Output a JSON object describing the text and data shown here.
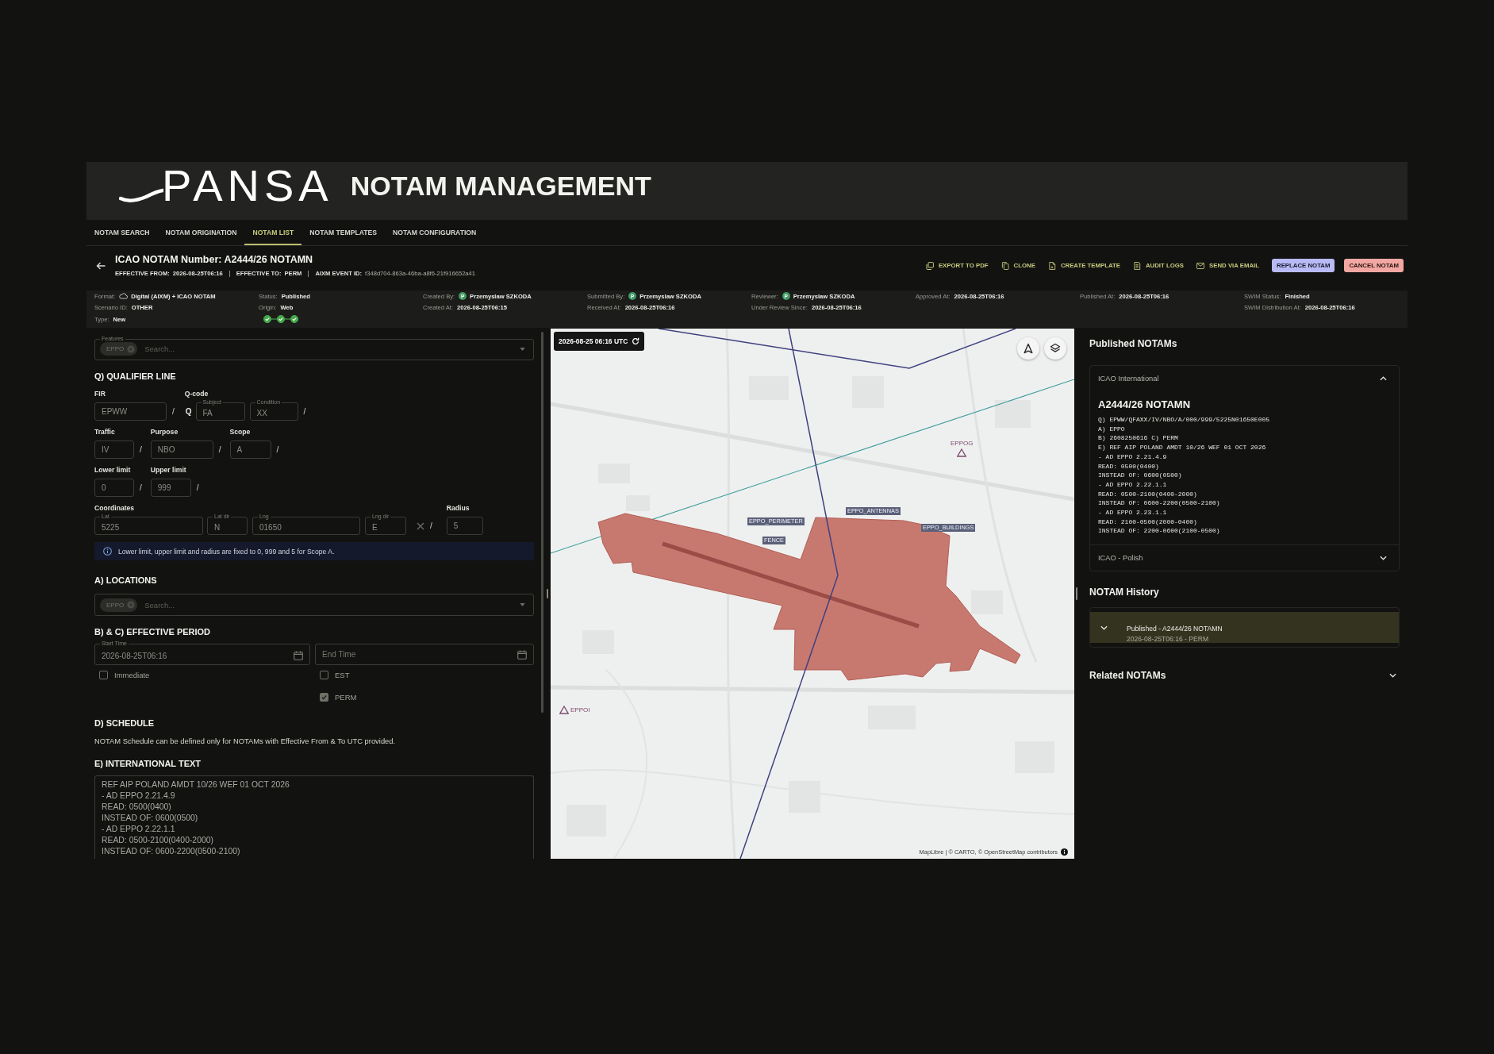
{
  "header": {
    "logo": "PANSA",
    "title": "NOTAM MANAGEMENT"
  },
  "tabs": [
    {
      "label": "NOTAM SEARCH",
      "selected": false
    },
    {
      "label": "NOTAM ORIGINATION",
      "selected": false
    },
    {
      "label": "NOTAM LIST",
      "selected": true
    },
    {
      "label": "NOTAM TEMPLATES",
      "selected": false
    },
    {
      "label": "NOTAM CONFIGURATION",
      "selected": false
    }
  ],
  "notam": {
    "title": "ICAO NOTAM Number: A2444/26 NOTAMN",
    "meta": [
      {
        "label": "EFFECTIVE FROM:",
        "value": "2026-08-25T06:16",
        "kind": "date"
      },
      {
        "label": "EFFECTIVE TO:",
        "value": "PERM",
        "kind": "date"
      },
      {
        "label": "AIXM EVENT ID:",
        "value": "f348d704-863a-46ba-a8f6-21f916652a41",
        "kind": "id"
      }
    ]
  },
  "actions": [
    {
      "label": "EXPORT TO PDF",
      "kind": "link"
    },
    {
      "label": "CLONE",
      "kind": "link"
    },
    {
      "label": "CREATE TEMPLATE",
      "kind": "link"
    },
    {
      "label": "AUDIT LOGS",
      "kind": "link"
    },
    {
      "label": "SEND VIA EMAIL",
      "kind": "link"
    },
    {
      "label": "REPLACE NOTAM",
      "kind": "primary"
    },
    {
      "label": "CANCEL NOTAM",
      "kind": "danger"
    }
  ],
  "details": [
    {
      "rows": [
        {
          "kind": "format",
          "label": "Format:",
          "value": "Digital (AIXM) + ICAO NOTAM"
        },
        {
          "kind": "text",
          "label": "Scenario ID:",
          "value": "OTHER"
        },
        {
          "kind": "text",
          "label": "Type:",
          "value": "New"
        }
      ]
    },
    {
      "rows": [
        {
          "kind": "text",
          "label": "Status:",
          "value": "Published"
        },
        {
          "kind": "text",
          "label": "Origin:",
          "value": "Web"
        },
        {
          "kind": "steps",
          "steps": [
            {
              "done": true
            },
            {
              "done": true
            },
            {
              "done": true
            }
          ]
        }
      ]
    },
    {
      "rows": [
        {
          "kind": "user",
          "label": "Created By:",
          "initial": "P",
          "value": "Przemyslaw SZKODA"
        },
        {
          "kind": "text",
          "label": "Created At:",
          "value": "2026-08-25T06:15"
        }
      ]
    },
    {
      "rows": [
        {
          "kind": "user",
          "label": "Submitted By:",
          "initial": "P",
          "value": "Przemyslaw SZKODA"
        },
        {
          "kind": "text",
          "label": "Received At:",
          "value": "2026-08-25T06:16"
        }
      ]
    },
    {
      "rows": [
        {
          "kind": "user",
          "label": "Reviewer:",
          "initial": "P",
          "value": "Przemyslaw SZKODA"
        },
        {
          "kind": "text",
          "label": "Under Review Since:",
          "value": "2026-08-25T06:16"
        }
      ]
    },
    {
      "rows": [
        {
          "kind": "text",
          "label": "Approved At:",
          "value": "2026-08-25T06:16"
        }
      ]
    },
    {
      "rows": [
        {
          "kind": "text",
          "label": "Published At:",
          "value": "2026-08-25T06:16"
        }
      ]
    },
    {
      "rows": [
        {
          "kind": "text",
          "label": "SWIM Status:",
          "value": "Finished"
        },
        {
          "kind": "text",
          "label": "SWIM Distribution At:",
          "value": "2026-08-25T06:16"
        }
      ]
    }
  ],
  "form": {
    "features": {
      "legend": "Features",
      "chips": [
        "EPPO"
      ],
      "placeholder": "Search..."
    },
    "qualifier": {
      "heading": "Q) QUALIFIER LINE",
      "fir": {
        "label": "FIR",
        "value": "EPWW",
        "suffix": "/"
      },
      "qcode": {
        "label": "Q-code",
        "prefix": "Q",
        "subject": {
          "legend": "Subject",
          "value": "FA"
        },
        "condition": {
          "legend": "Condition",
          "value": "XX",
          "suffix": "/"
        }
      },
      "rows": [
        [
          {
            "label": "Traffic",
            "value": "IV",
            "suffix": "/"
          },
          {
            "label": "Purpose",
            "value": "NBO",
            "suffix": "/"
          },
          {
            "label": "Scope",
            "value": "A",
            "suffix": "/"
          }
        ],
        [
          {
            "label": "Lower limit",
            "value": "0",
            "suffix": "/"
          },
          {
            "label": "Upper limit",
            "value": "999",
            "suffix": "/"
          }
        ]
      ],
      "coordinates": {
        "label": "Coordinates",
        "fields": [
          {
            "legend": "Lat",
            "value": "5225"
          },
          {
            "legend": "Lat dir",
            "value": "N"
          },
          {
            "legend": "Lng",
            "value": "01650"
          },
          {
            "legend": "Lng dir",
            "value": "E"
          }
        ],
        "suffix": "/"
      },
      "radius": {
        "label": "Radius",
        "value": "5"
      },
      "info": "Lower limit, upper limit and radius are fixed to 0, 999 and 5 for Scope A."
    },
    "locations": {
      "heading": "A) LOCATIONS",
      "chips": [
        "EPPO"
      ],
      "placeholder": "Search..."
    },
    "period": {
      "heading": "B) & C) EFFECTIVE PERIOD",
      "start": {
        "legend": "Start Time",
        "value": "2026-08-25T06:16",
        "checks": [
          {
            "label": "Immediate",
            "checked": false
          }
        ]
      },
      "end": {
        "placeholder": "End Time",
        "checks": [
          {
            "label": "EST",
            "checked": false
          },
          {
            "label": "PERM",
            "checked": true
          }
        ]
      }
    },
    "schedule": {
      "heading": "D) SCHEDULE",
      "note": "NOTAM Schedule can be defined only for NOTAMs with Effective From & To UTC provided."
    },
    "text": {
      "heading": "E) INTERNATIONAL TEXT",
      "value": "REF AIP POLAND AMDT 10/26 WEF 01 OCT 2026\n- AD EPPO 2.21.4.9\nREAD: 0500(0400)\nINSTEAD OF: 0600(0500)\n- AD EPPO 2.22.1.1\nREAD: 0500-2100(0400-2000)\nINSTEAD OF: 0600-2200(0500-2100)"
    }
  },
  "map": {
    "timestamp": "2026-08-25 06:16 UTC",
    "overlays": [
      {
        "kind": "marker",
        "label": "EPPOG"
      },
      {
        "kind": "label",
        "label": "EPPO_ANTENNAS"
      },
      {
        "kind": "label",
        "label": "EPPO_PERIMETER"
      },
      {
        "kind": "label",
        "label": "EPPO_BUILDINGS"
      },
      {
        "kind": "label",
        "label": "FENCE"
      },
      {
        "kind": "marker",
        "label": "EPPOI"
      }
    ],
    "attribution": "MapLibre | © CARTO, © OpenStreetMap contributors"
  },
  "published": {
    "heading": "Published NOTAMs",
    "sections": [
      {
        "title": "ICAO International",
        "expanded": true,
        "notam_id": "A2444/26 NOTAMN",
        "text": "Q) EPWW/QFAXX/IV/NBO/A/000/999/5225N01650E005\nA) EPPO\nB) 2608250616 C) PERM\nE) REF AIP POLAND AMDT 10/26 WEF 01 OCT 2026\n- AD EPPO 2.21.4.9\nREAD: 0500(0400)\nINSTEAD OF: 0600(0500)\n- AD EPPO 2.22.1.1\nREAD: 0500-2100(0400-2000)\nINSTEAD OF: 0600-2200(0500-2100)\n- AD EPPO 2.23.1.1\nREAD: 2100-0500(2000-0400)\nINSTEAD OF: 2200-0600(2100-0500)"
      },
      {
        "title": "ICAO - Polish",
        "expanded": false
      }
    ]
  },
  "history": {
    "heading": "NOTAM History",
    "items": [
      {
        "title": "Published - A2444/26 NOTAMN",
        "subtitle": "2026-08-25T06:16 - PERM",
        "selected": true,
        "expanded": false
      }
    ]
  },
  "related": {
    "heading": "Related NOTAMs",
    "expanded": false
  }
}
